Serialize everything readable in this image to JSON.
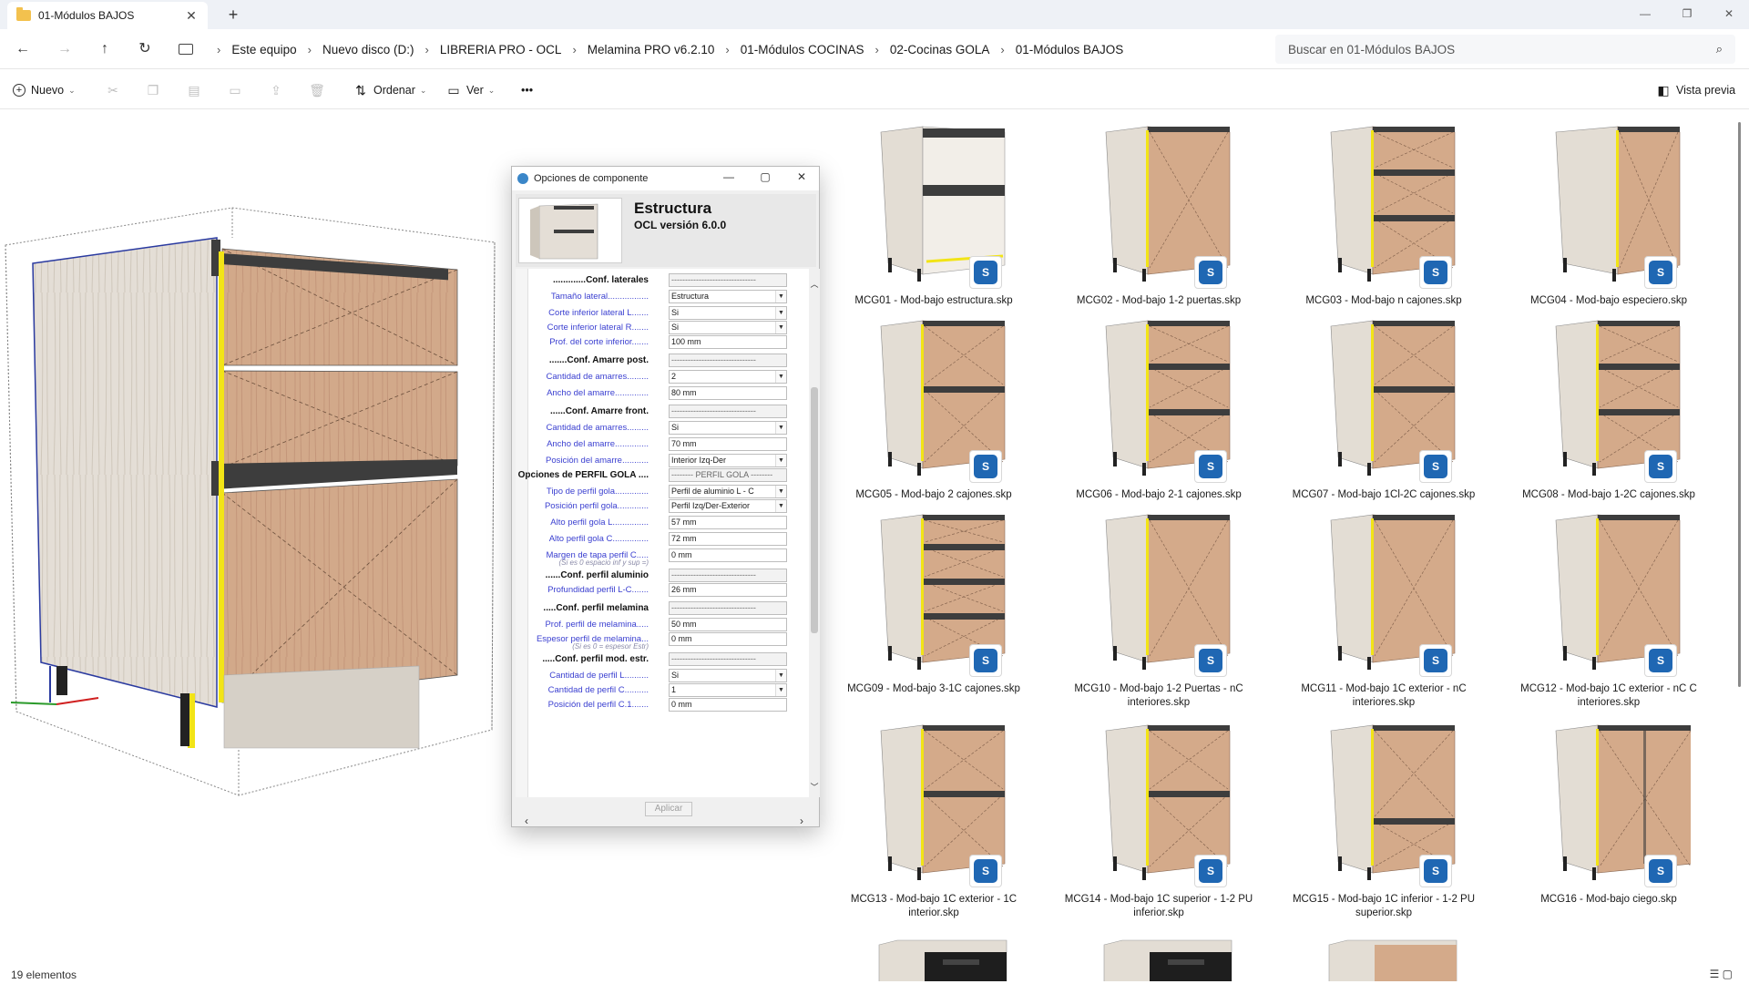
{
  "tab": {
    "title": "01-Módulos BAJOS",
    "close": "✕",
    "new": "+"
  },
  "window": {
    "min": "—",
    "max": "❐",
    "close": "✕"
  },
  "nav": {
    "back": "←",
    "forward": "→",
    "up": "↑",
    "refresh": "↻"
  },
  "breadcrumb": [
    "Este equipo",
    "Nuevo disco (D:)",
    "LIBRERIA PRO - OCL",
    "Melamina PRO v6.2.10",
    "01-Módulos COCINAS",
    "02-Cocinas GOLA",
    "01-Módulos BAJOS"
  ],
  "search": {
    "placeholder": "Buscar en 01-Módulos BAJOS",
    "icon": "search-icon"
  },
  "commands": {
    "new": "Nuevo",
    "sort": "Ordenar",
    "view": "Ver",
    "more": "•••",
    "preview": "Vista previa"
  },
  "dialog": {
    "title": "Opciones de componente",
    "name": "Estructura",
    "version": "OCL versión 6.0.0",
    "apply": "Aplicar",
    "rows": [
      {
        "label": ".............Conf. laterales",
        "kind": "section",
        "value": "-------------------------------"
      },
      {
        "label": "Tamaño lateral.................",
        "kind": "link",
        "value": "Estructura",
        "dd": true
      },
      {
        "label": "Corte inferior lateral L.......",
        "kind": "link",
        "value": "Si",
        "dd": true
      },
      {
        "label": "Corte inferior lateral R.......",
        "kind": "link",
        "value": "Si",
        "dd": true
      },
      {
        "label": "Prof. del corte inferior.......",
        "kind": "link",
        "value": "100 mm"
      },
      {
        "label": ".......Conf. Amarre post.",
        "kind": "section",
        "value": "-------------------------------"
      },
      {
        "label": "Cantidad de amarres.........",
        "kind": "link",
        "value": "2",
        "dd": true
      },
      {
        "label": "Ancho del amarre..............",
        "kind": "link",
        "value": "80 mm"
      },
      {
        "label": "......Conf. Amarre front.",
        "kind": "section",
        "value": "-------------------------------"
      },
      {
        "label": "Cantidad de amarres.........",
        "kind": "link",
        "value": "Si",
        "dd": true
      },
      {
        "label": "Ancho del amarre..............",
        "kind": "link",
        "value": "70 mm"
      },
      {
        "label": "Posición del amarre...........",
        "kind": "link",
        "value": "Interior Izq-Der",
        "dd": true
      },
      {
        "label": "Opciones de PERFIL GOLA ....",
        "kind": "section",
        "value": "-------- PERFIL GOLA --------"
      },
      {
        "label": "Tipo de perfil gola..............",
        "kind": "link",
        "value": "Perfil de aluminio L - C",
        "dd": true
      },
      {
        "label": "Posición perfil gola.............",
        "kind": "link",
        "value": "Perfil Izq/Der-Exterior",
        "dd": true
      },
      {
        "label": "Alto perfil gola L...............",
        "kind": "link",
        "value": "57 mm"
      },
      {
        "label": "Alto perfil gola C...............",
        "kind": "link",
        "value": "72 mm"
      },
      {
        "label": "Margen de tapa perfil C.....",
        "kind": "link",
        "value": "0 mm",
        "note": "(Si es 0 espacio inf y sup =)"
      },
      {
        "label": "......Conf. perfil aluminio",
        "kind": "section",
        "value": "-------------------------------"
      },
      {
        "label": "Profundidad perfil L-C.......",
        "kind": "link",
        "value": "26 mm"
      },
      {
        "label": ".....Conf. perfil melamina",
        "kind": "section",
        "value": "-------------------------------"
      },
      {
        "label": "Prof. perfil de melamina.....",
        "kind": "link",
        "value": "50 mm"
      },
      {
        "label": "Espesor perfil de melamina...",
        "kind": "link",
        "value": "0 mm",
        "note": "(Si es 0 = espesor Estr)"
      },
      {
        "label": ".....Conf. perfil mod. estr.",
        "kind": "section",
        "value": "-------------------------------"
      },
      {
        "label": "Cantidad de perfil L..........",
        "kind": "link",
        "value": "Si",
        "dd": true
      },
      {
        "label": "Cantidad de perfil C..........",
        "kind": "link",
        "value": "1",
        "dd": true
      },
      {
        "label": "Posición del perfil C.1.......",
        "kind": "link",
        "value": "0 mm"
      }
    ]
  },
  "files": [
    {
      "name": "MCG01 - Mod-bajo estructura.skp",
      "style": "open"
    },
    {
      "name": "MCG02 - Mod-bajo 1-2 puertas.skp",
      "style": "door"
    },
    {
      "name": "MCG03 - Mod-bajo n cajones.skp",
      "style": "drawers3"
    },
    {
      "name": "MCG04 - Mod-bajo especiero.skp",
      "style": "narrow"
    },
    {
      "name": "MCG05 - Mod-bajo 2 cajones.skp",
      "style": "drawers2"
    },
    {
      "name": "MCG06 - Mod-bajo 2-1 cajones.skp",
      "style": "drawers3"
    },
    {
      "name": "MCG07 - Mod-bajo 1Cl-2C cajones.skp",
      "style": "drawers2"
    },
    {
      "name": "MCG08 - Mod-bajo 1-2C cajones.skp",
      "style": "drawers3"
    },
    {
      "name": "MCG09 - Mod-bajo 3-1C cajones.skp",
      "style": "drawers4"
    },
    {
      "name": "MCG10 - Mod-bajo 1-2 Puertas - nC interiores.skp",
      "style": "door"
    },
    {
      "name": "MCG11 - Mod-bajo 1C exterior - nC interiores.skp",
      "style": "door"
    },
    {
      "name": "MCG12 - Mod-bajo 1C exterior - nC C interiores.skp",
      "style": "door"
    },
    {
      "name": "MCG13 - Mod-bajo 1C exterior - 1C interior.skp",
      "style": "drawers2"
    },
    {
      "name": "MCG14 - Mod-bajo 1C superior - 1-2 PU inferior.skp",
      "style": "drawers2"
    },
    {
      "name": "MCG15 - Mod-bajo 1C inferior - 1-2 PU superior.skp",
      "style": "drawers2b"
    },
    {
      "name": "MCG16 - Mod-bajo ciego.skp",
      "style": "wide"
    },
    {
      "name": "",
      "style": "oven"
    },
    {
      "name": "",
      "style": "oven"
    },
    {
      "name": "",
      "style": "partial"
    }
  ],
  "status": {
    "count": "19 elementos",
    "views": "☰ ▢"
  },
  "colors": {
    "wood": "#d4aa8a",
    "side": "#e3ddd4",
    "gola": "#3d3d3d",
    "yellow": "#f2e416",
    "accent": "#1f67b3"
  }
}
